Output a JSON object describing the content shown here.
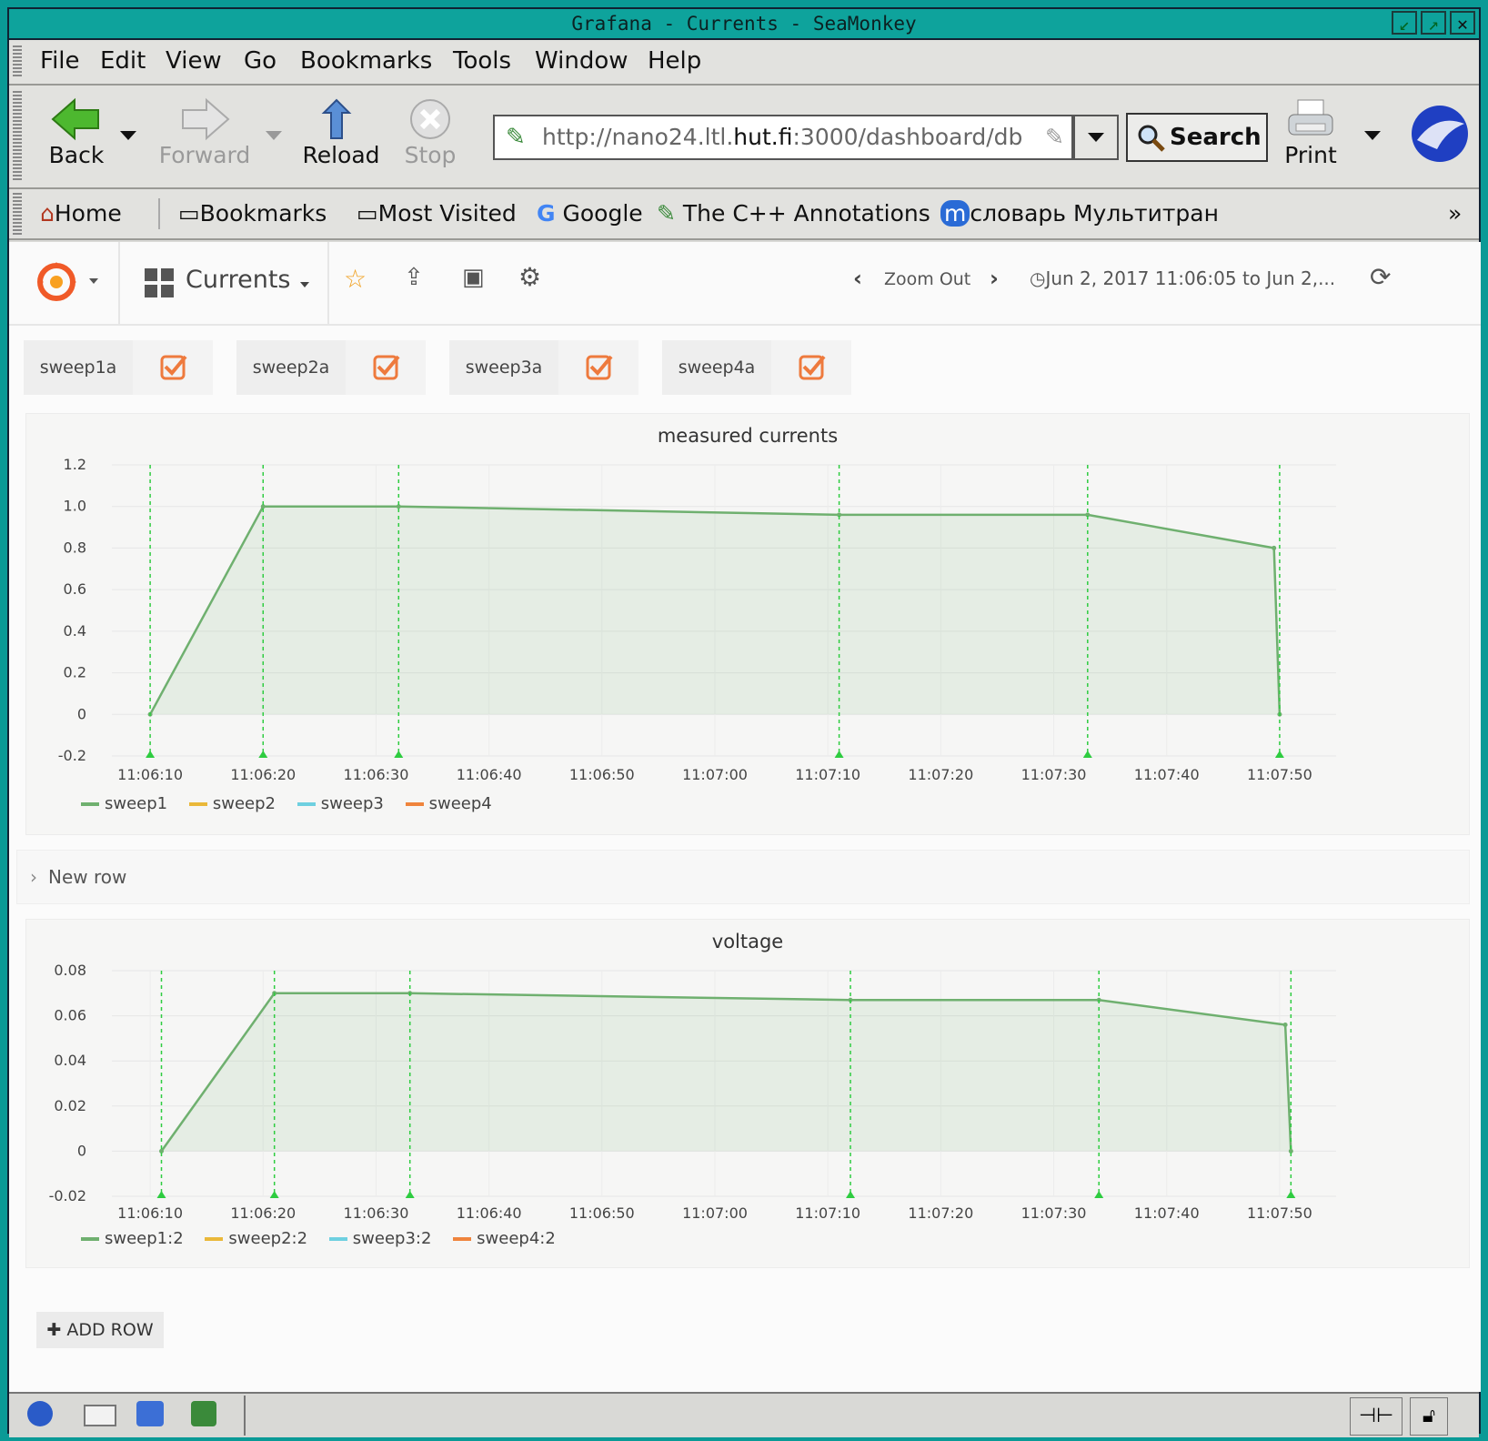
{
  "window": {
    "title": "Grafana - Currents - SeaMonkey"
  },
  "menu": [
    "File",
    "Edit",
    "View",
    "Go",
    "Bookmarks",
    "Tools",
    "Window",
    "Help"
  ],
  "nav": {
    "back": "Back",
    "forward": "Forward",
    "reload": "Reload",
    "stop": "Stop",
    "print": "Print",
    "url_pre": "http://nano24.ltl.",
    "url_host": "hut.fi",
    "url_post": ":3000/dashboard/db",
    "search": "Search"
  },
  "bookmarks": {
    "home": "Home",
    "bookmarks": "Bookmarks",
    "most_visited": "Most Visited",
    "google": "Google",
    "cpp": "The C++ Annotations",
    "multitran": "словарь Мультитран",
    "more": "»"
  },
  "grafana": {
    "dashboard": "Currents",
    "zoom_out": "Zoom Out",
    "time_range": "Jun 2, 2017 11:06:05 to Jun 2,..."
  },
  "templating": [
    {
      "label": "sweep1a"
    },
    {
      "label": "sweep2a"
    },
    {
      "label": "sweep3a"
    },
    {
      "label": "sweep4a"
    }
  ],
  "new_row": "New row",
  "add_row": "ADD ROW",
  "colors": {
    "accent": "#ee7a3d",
    "series1": "#6fb06f",
    "series2": "#eab839",
    "series3": "#6ed0e0",
    "series4": "#ef843c",
    "annotation": "#2ecc40"
  },
  "chart_data": [
    {
      "type": "line",
      "title": "measured currents",
      "ylim": [
        -0.2,
        1.2
      ],
      "yticks": [
        "1.2",
        "1.0",
        "0.8",
        "0.6",
        "0.4",
        "0.2",
        "0",
        "-0.2"
      ],
      "xticks": [
        "11:06:10",
        "11:06:20",
        "11:06:30",
        "11:06:40",
        "11:06:50",
        "11:07:00",
        "11:07:10",
        "11:07:20",
        "11:07:30",
        "11:07:40",
        "11:07:50"
      ],
      "annotations": [
        "11:06:10",
        "11:06:20",
        "11:06:32",
        "11:07:11",
        "11:07:33",
        "11:07:50"
      ],
      "series": [
        {
          "name": "sweep1",
          "x": [
            "11:06:10",
            "11:06:20",
            "11:06:32",
            "11:07:11",
            "11:07:33",
            "11:07:49.5",
            "11:07:50"
          ],
          "values": [
            0.0,
            1.0,
            1.0,
            0.96,
            0.96,
            0.8,
            0.0
          ]
        },
        {
          "name": "sweep2",
          "x": [],
          "values": []
        },
        {
          "name": "sweep3",
          "x": [],
          "values": []
        },
        {
          "name": "sweep4",
          "x": [],
          "values": []
        }
      ]
    },
    {
      "type": "line",
      "title": "voltage",
      "ylim": [
        -0.02,
        0.08
      ],
      "yticks": [
        "0.08",
        "0.06",
        "0.04",
        "0.02",
        "0",
        "-0.02"
      ],
      "xticks": [
        "11:06:10",
        "11:06:20",
        "11:06:30",
        "11:06:40",
        "11:06:50",
        "11:07:00",
        "11:07:10",
        "11:07:20",
        "11:07:30",
        "11:07:40",
        "11:07:50"
      ],
      "annotations": [
        "11:06:11",
        "11:06:21",
        "11:06:33",
        "11:07:12",
        "11:07:34",
        "11:07:51"
      ],
      "series": [
        {
          "name": "sweep1:2",
          "x": [
            "11:06:11",
            "11:06:21",
            "11:06:33",
            "11:07:12",
            "11:07:34",
            "11:07:50.5",
            "11:07:51"
          ],
          "values": [
            0.0,
            0.07,
            0.07,
            0.067,
            0.067,
            0.056,
            0.0
          ]
        },
        {
          "name": "sweep2:2",
          "x": [],
          "values": []
        },
        {
          "name": "sweep3:2",
          "x": [],
          "values": []
        },
        {
          "name": "sweep4:2",
          "x": [],
          "values": []
        }
      ]
    }
  ]
}
